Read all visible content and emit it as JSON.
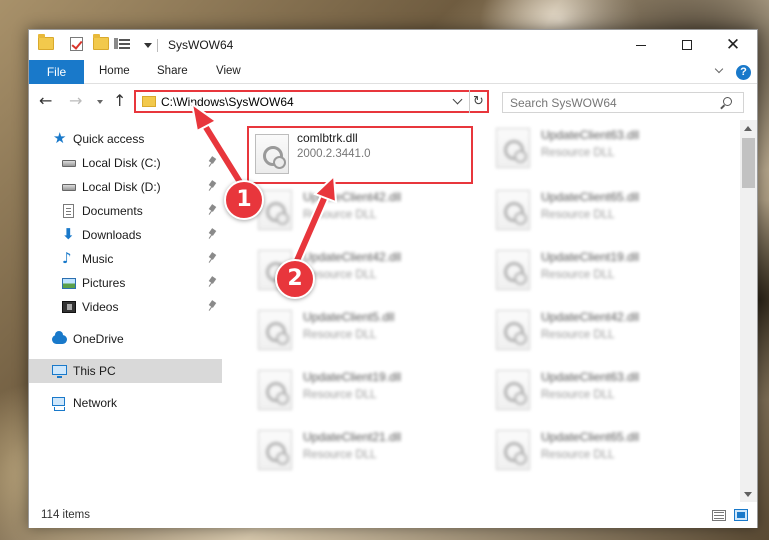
{
  "window": {
    "title": "SysWOW64"
  },
  "ribbon": {
    "file": "File",
    "home": "Home",
    "share": "Share",
    "view": "View"
  },
  "nav": {
    "address": "C:\\Windows\\SysWOW64",
    "search_placeholder": "Search SysWOW64"
  },
  "sidebar": {
    "items": [
      {
        "label": "Quick access",
        "icon": "star-icon"
      },
      {
        "label": "Local Disk (C:)",
        "icon": "drive-icon",
        "pinned": true
      },
      {
        "label": "Local Disk (D:)",
        "icon": "drive-icon",
        "pinned": true
      },
      {
        "label": "Documents",
        "icon": "documents-icon",
        "pinned": true
      },
      {
        "label": "Downloads",
        "icon": "downloads-icon",
        "pinned": true
      },
      {
        "label": "Music",
        "icon": "music-icon",
        "pinned": true
      },
      {
        "label": "Pictures",
        "icon": "pictures-icon",
        "pinned": true
      },
      {
        "label": "Videos",
        "icon": "videos-icon",
        "pinned": true
      },
      {
        "label": "OneDrive",
        "icon": "cloud-icon"
      },
      {
        "label": "This PC",
        "icon": "computer-icon",
        "selected": true
      },
      {
        "label": "Network",
        "icon": "network-icon"
      }
    ]
  },
  "files": {
    "focused": {
      "name": "comlbtrk.dll",
      "detail": "2000.2.3441.0"
    },
    "left_column": [
      {
        "name": "UpdateClient42.dll",
        "detail": "Resource DLL"
      },
      {
        "name": "UpdateClient42.dll",
        "detail": "Resource DLL"
      },
      {
        "name": "UpdateClient5.dll",
        "detail": "Resource DLL"
      },
      {
        "name": "UpdateClient19.dll",
        "detail": "Resource DLL"
      },
      {
        "name": "UpdateClient21.dll",
        "detail": "Resource DLL"
      }
    ],
    "right_column": [
      {
        "name": "UpdateClient63.dll",
        "detail": "Resource DLL"
      },
      {
        "name": "UpdateClient65.dll",
        "detail": "Resource DLL"
      },
      {
        "name": "UpdateClient19.dll",
        "detail": "Resource DLL"
      },
      {
        "name": "UpdateClient42.dll",
        "detail": "Resource DLL"
      },
      {
        "name": "UpdateClient63.dll",
        "detail": "Resource DLL"
      },
      {
        "name": "UpdateClient65.dll",
        "detail": "Resource DLL"
      }
    ]
  },
  "status": {
    "items": "114 items"
  },
  "annotations": {
    "step1": "1",
    "step2": "2",
    "color": "#e8363c"
  }
}
